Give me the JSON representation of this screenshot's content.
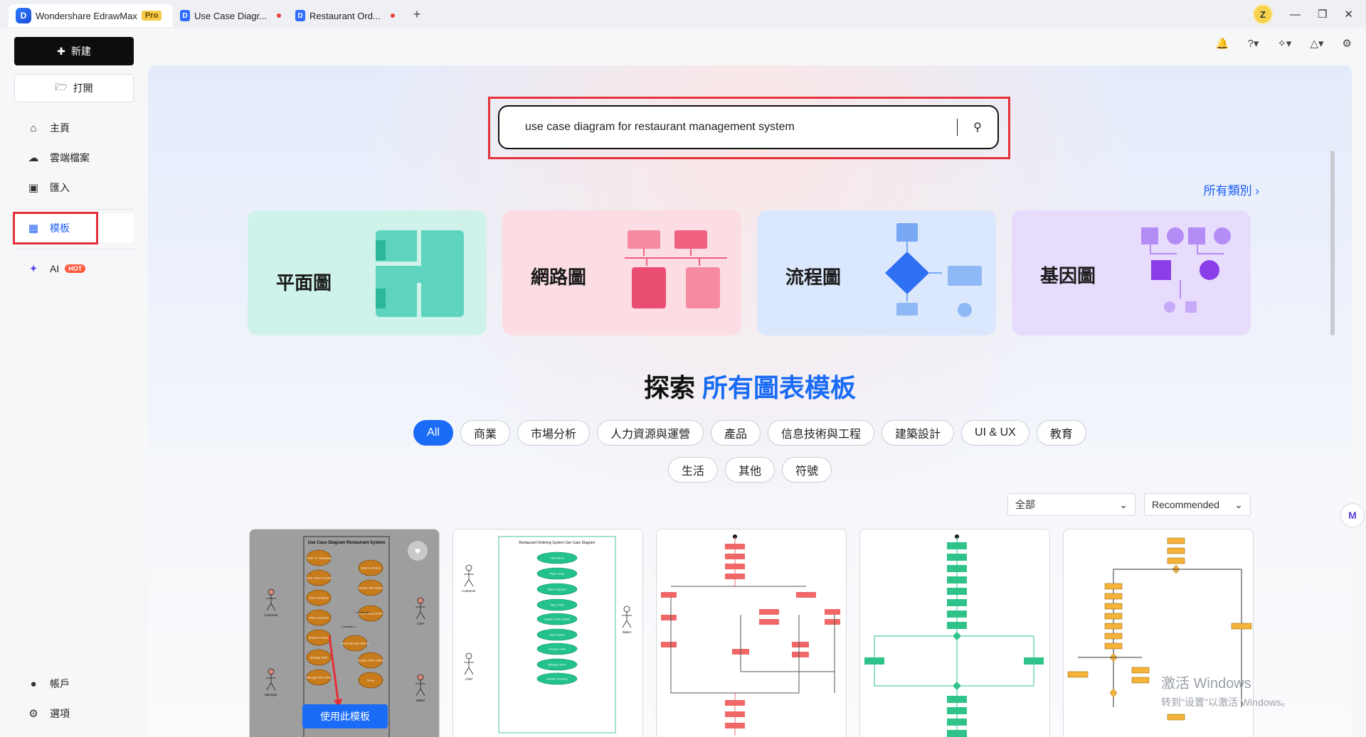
{
  "titlebar": {
    "app_title": "Wondershare EdrawMax",
    "pro": "Pro",
    "tabs": [
      {
        "label": "Use Case Diagr..."
      },
      {
        "label": "Restaurant Ord..."
      }
    ],
    "avatar": "Z"
  },
  "sidebar": {
    "new_label": "新建",
    "open_label": "打開",
    "items": [
      {
        "label": "主頁",
        "icon": "home-icon"
      },
      {
        "label": "雲端檔案",
        "icon": "cloud-icon"
      },
      {
        "label": "匯入",
        "icon": "import-icon"
      },
      {
        "label": "模板",
        "icon": "template-icon"
      },
      {
        "label": "AI",
        "icon": "ai-sparkle-icon",
        "badge": "HOT"
      }
    ],
    "bottom_items": [
      {
        "label": "帳戶",
        "icon": "account-icon"
      },
      {
        "label": "選項",
        "icon": "gear-icon"
      }
    ]
  },
  "search": {
    "value": "use case diagram for restaurant management system"
  },
  "all_categories": "所有類別",
  "categories": [
    {
      "label": "平面圖"
    },
    {
      "label": "網路圖"
    },
    {
      "label": "流程圖"
    },
    {
      "label": "基因圖"
    }
  ],
  "explore": {
    "prefix": "探索",
    "highlight": "所有圖表模板"
  },
  "filters_row1": [
    "All",
    "商業",
    "市場分析",
    "人力資源與運營",
    "產品",
    "信息技術與工程",
    "建築設計",
    "UI & UX",
    "教育"
  ],
  "filters_row2": [
    "生活",
    "其他",
    "符號"
  ],
  "sort": {
    "scope": "全部",
    "order": "Recommended"
  },
  "templates": {
    "use_button": "使用此模板",
    "card1": {
      "title": "Use Case Diagram Restaurant System",
      "actors": [
        "Customer",
        "Manager",
        "Chef",
        "Waiter"
      ],
      "cases": [
        "Order for Takeaway",
        "Place Order to Order",
        "Give Feedback",
        "Make Payment",
        "Browse Product",
        "Manage Staff",
        "Manage Menu Item",
        "Send to Kitchen",
        "Update Dish Status",
        "Pay Pending Order",
        "Generate Sale Report",
        "Update Order Status",
        "Serve"
      ],
      "rel": [
        "<<include>>",
        "<<extends>>"
      ]
    },
    "card2": {
      "title": "Restaurant Ordering System Use Case Diagram",
      "actors": [
        "Customer",
        "Waiter",
        "Chef"
      ],
      "cases": [
        "View Menu",
        "Place Order",
        "Make Payment",
        "Take Order",
        "Update Order Status",
        "View Orders",
        "Prepare meal",
        "Manage Menu",
        "Handle Inventory"
      ]
    }
  },
  "watermark": {
    "line1": "激活 Windows",
    "line2": "转到\"设置\"以激活 Windows。"
  }
}
